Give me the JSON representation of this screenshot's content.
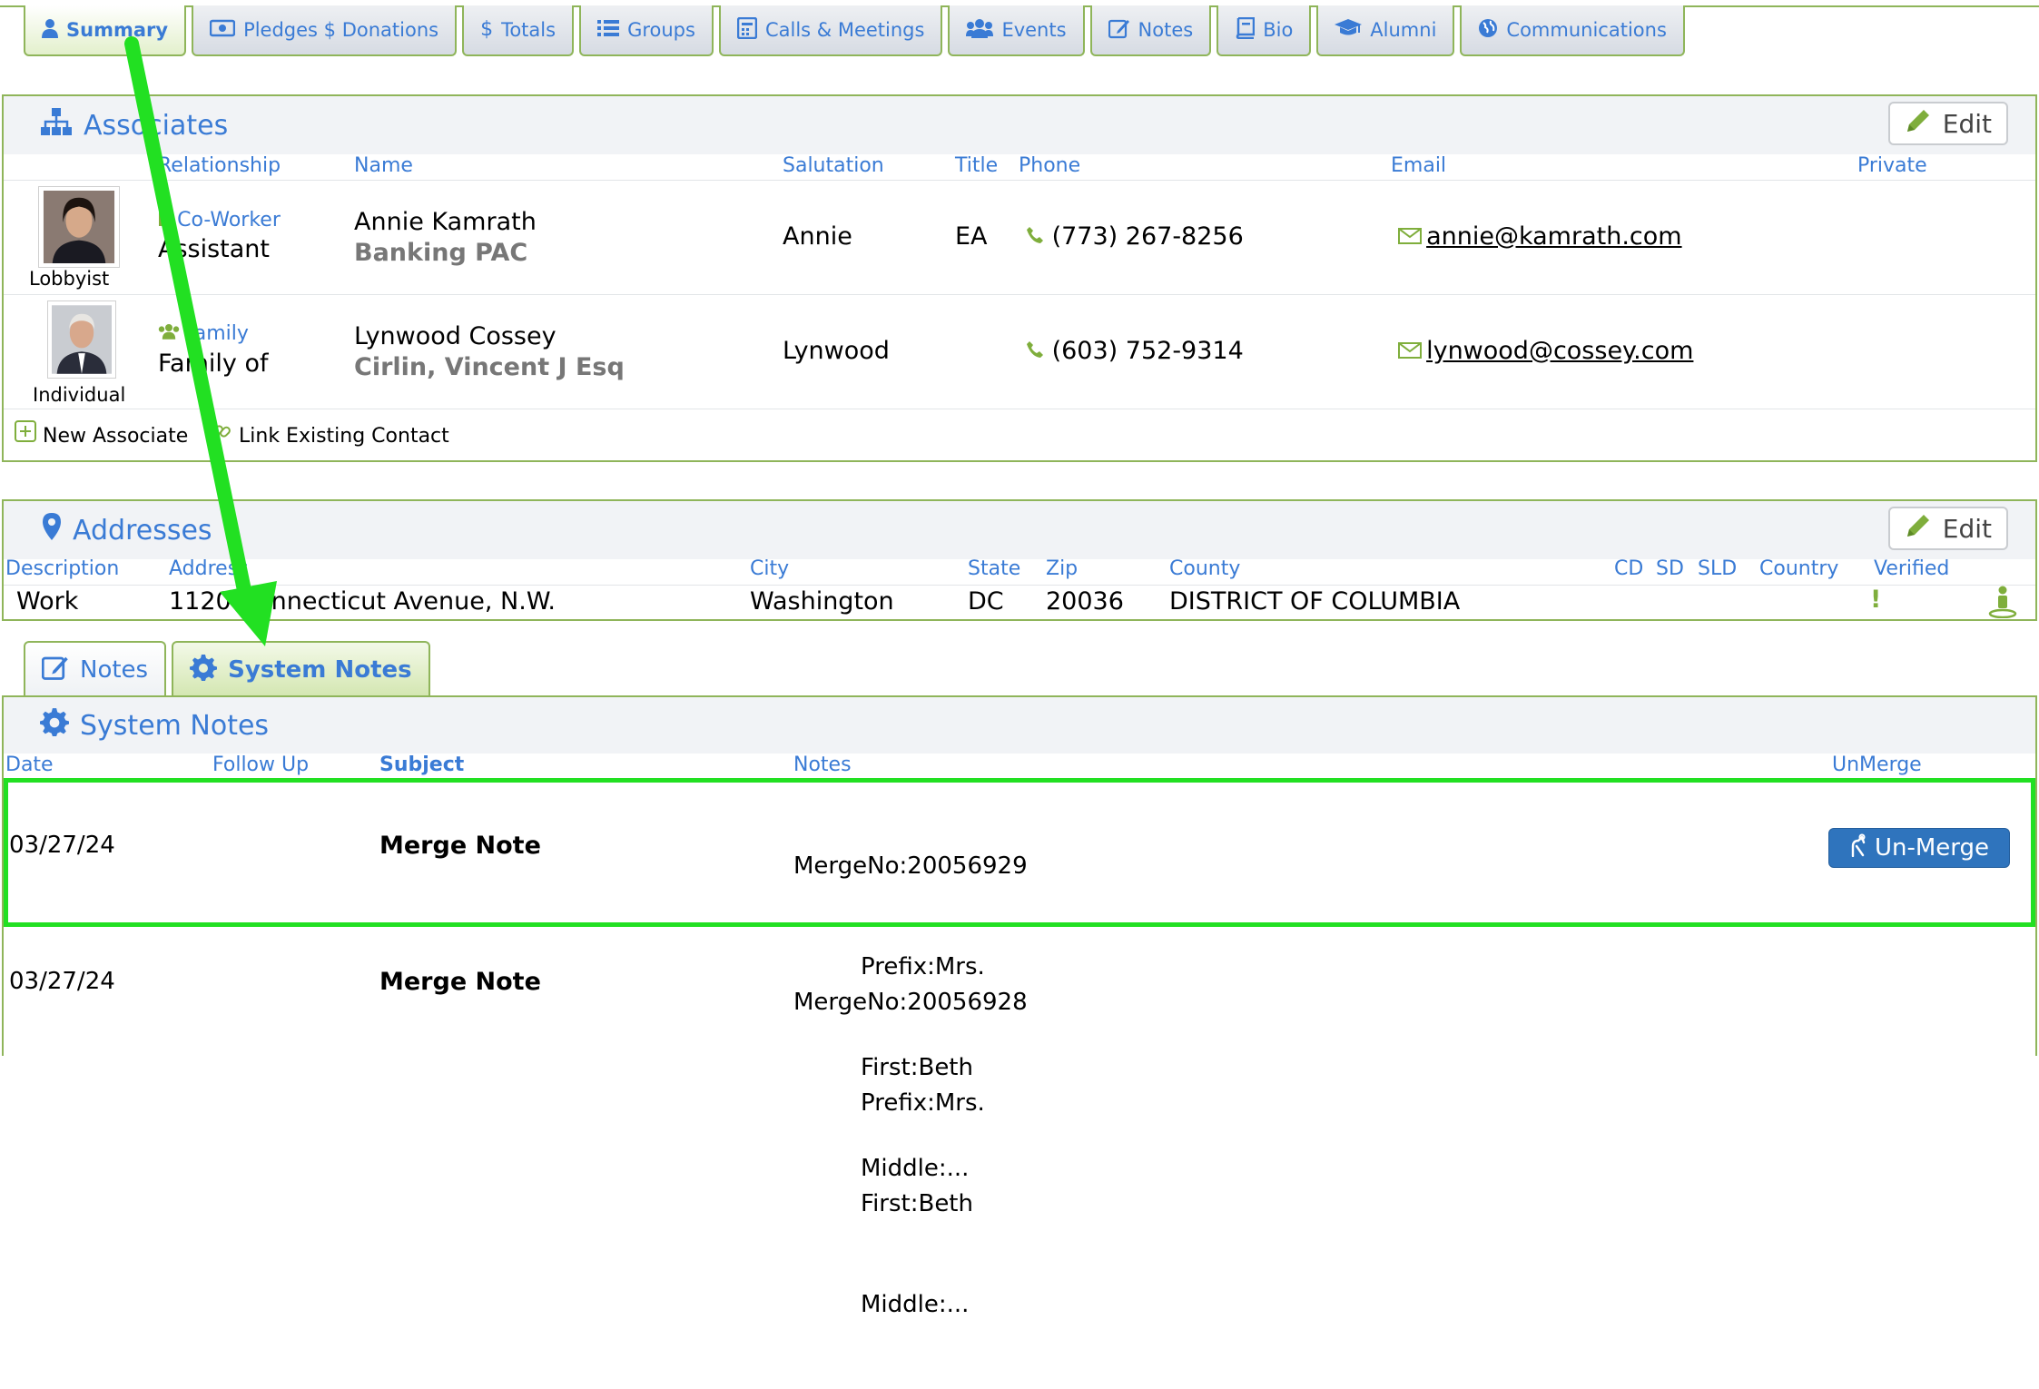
{
  "tabs": [
    {
      "label": "Summary",
      "icon": "user-icon",
      "active": true
    },
    {
      "label": "Pledges $ Donations",
      "icon": "money-icon"
    },
    {
      "label": "Totals",
      "icon": "dollar-icon"
    },
    {
      "label": "Groups",
      "icon": "list-icon"
    },
    {
      "label": "Calls & Meetings",
      "icon": "phone-book-icon"
    },
    {
      "label": "Events",
      "icon": "users-icon"
    },
    {
      "label": "Notes",
      "icon": "edit-icon"
    },
    {
      "label": "Bio",
      "icon": "book-icon"
    },
    {
      "label": "Alumni",
      "icon": "graduation-cap-icon"
    },
    {
      "label": "Communications",
      "icon": "globe-icon"
    }
  ],
  "associates": {
    "title": "Associates",
    "edit_label": "Edit",
    "columns": {
      "relationship": "Relationship",
      "name": "Name",
      "salutation": "Salutation",
      "title": "Title",
      "phone": "Phone",
      "email": "Email",
      "private": "Private"
    },
    "rows": [
      {
        "photo_caption": "Lobbyist",
        "rel_type": "Co-Worker",
        "rel_desc": "Assistant",
        "name": "Annie Kamrath",
        "org": "Banking PAC",
        "salutation": "Annie",
        "title": "EA",
        "phone": "(773) 267-8256",
        "email": "annie@kamrath.com"
      },
      {
        "photo_caption": "Individual",
        "rel_type": "Family",
        "rel_desc": "Family of",
        "name": "Lynwood Cossey",
        "org": "Cirlin, Vincent J Esq",
        "salutation": "Lynwood",
        "title": "",
        "phone": "(603) 752-9314",
        "email": "lynwood@cossey.com"
      }
    ],
    "new_associate": "New Associate",
    "link_existing": "Link Existing Contact"
  },
  "addresses": {
    "title": "Addresses",
    "edit_label": "Edit",
    "columns": {
      "description": "Description",
      "address": "Address",
      "city": "City",
      "state": "State",
      "zip": "Zip",
      "county": "County",
      "cd": "CD",
      "sd": "SD",
      "sld": "SLD",
      "country": "Country",
      "verified": "Verified"
    },
    "row": {
      "description": "Work",
      "address": "1120 Connecticut Avenue, N.W.",
      "city": "Washington",
      "state": "DC",
      "zip": "20036",
      "county": "DISTRICT OF COLUMBIA",
      "verified": "!"
    }
  },
  "notes_tabs": [
    {
      "label": "Notes",
      "icon": "edit-icon"
    },
    {
      "label": "System Notes",
      "icon": "gear-icon",
      "active": true
    }
  ],
  "system_notes": {
    "title": "System Notes",
    "columns": {
      "date": "Date",
      "follow_up": "Follow Up",
      "subject": "Subject",
      "notes": "Notes",
      "unmerge": "UnMerge"
    },
    "rows": [
      {
        "date": "03/27/24",
        "subject": "Merge Note",
        "merge_no": "MergeNo:20056929",
        "prefix": "Prefix:Mrs.",
        "first": "First:Beth",
        "middle": "Middle:...",
        "button": "Un-Merge"
      },
      {
        "date": "03/27/24",
        "subject": "Merge Note",
        "merge_no": "MergeNo:20056928",
        "prefix": "Prefix:Mrs.",
        "first": "First:Beth",
        "middle": "Middle:..."
      }
    ]
  },
  "colors": {
    "accent": "#3a7bd5",
    "border": "#8fb55a",
    "highlight": "#22e022",
    "button": "#2f74bd"
  }
}
